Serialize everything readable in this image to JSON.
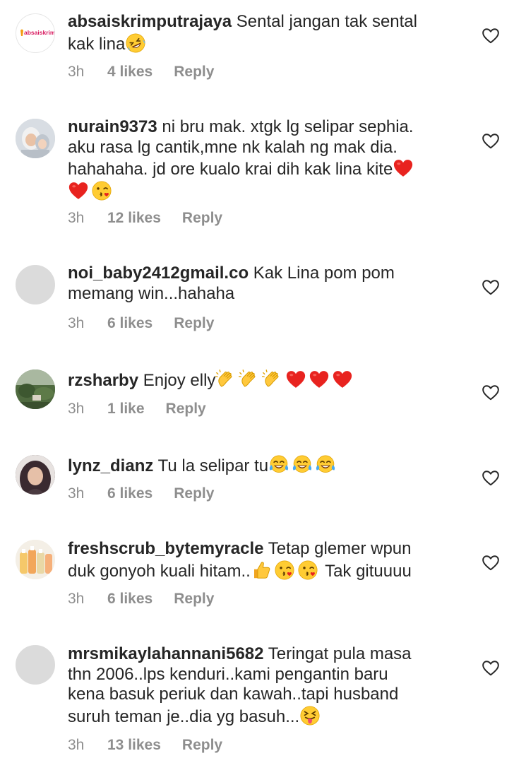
{
  "comments": [
    {
      "username": "absaiskrimputrajaya",
      "line1": "Sental jangan tak sental",
      "line2": "kak lina",
      "time": "3h",
      "likes": "4 likes",
      "reply": "Reply",
      "avatar_logo_text": "absaiskrim"
    },
    {
      "username": "nurain9373",
      "line1": "ni bru mak. xtgk lg selipar sephia.",
      "line2": "aku rasa lg cantik,mne nk kalah ng mak dia.",
      "line3": "hahahaha. jd ore kualo krai dih kak lina kite",
      "time": "3h",
      "likes": "12 likes",
      "reply": "Reply"
    },
    {
      "username": "noi_baby2412gmail.co",
      "line1": "Kak Lina pom pom",
      "line2": "memang win...hahaha",
      "time": "3h",
      "likes": "6 likes",
      "reply": "Reply"
    },
    {
      "username": "rzsharby",
      "line1": "Enjoy elly",
      "time": "3h",
      "likes": "1 like",
      "reply": "Reply"
    },
    {
      "username": "lynz_dianz",
      "line1": "Tu la selipar tu",
      "time": "3h",
      "likes": "6 likes",
      "reply": "Reply"
    },
    {
      "username": "freshscrub_bytemyracle",
      "line1": "Tetap glemer wpun",
      "line2": "duk gonyoh kuali hitam..",
      "line2_tail": "Tak gituuuu",
      "time": "3h",
      "likes": "6 likes",
      "reply": "Reply"
    },
    {
      "username": "mrsmikaylahannani5682",
      "line1": "Teringat pula masa",
      "line2": "thn 2006..lps kenduri..kami pengantin baru",
      "line3": "kena basuk periuk dan kawah..tapi husband",
      "line4": "suruh teman je..dia yg basuh...",
      "time": "3h",
      "likes": "13 likes",
      "reply": "Reply"
    }
  ],
  "colors": {
    "text": "#262626",
    "meta": "#8e8e8e",
    "heart_stroke": "#262626",
    "avatar_placeholder": "#dbdbdb"
  },
  "icons": {
    "like": "heart-outline-icon",
    "emojis": [
      "rofl-emoji",
      "red-heart-emoji",
      "kiss-wink-emoji",
      "clapping-hands-emoji",
      "tears-of-joy-emoji",
      "thumbs-up-emoji",
      "tongue-squint-emoji"
    ]
  }
}
